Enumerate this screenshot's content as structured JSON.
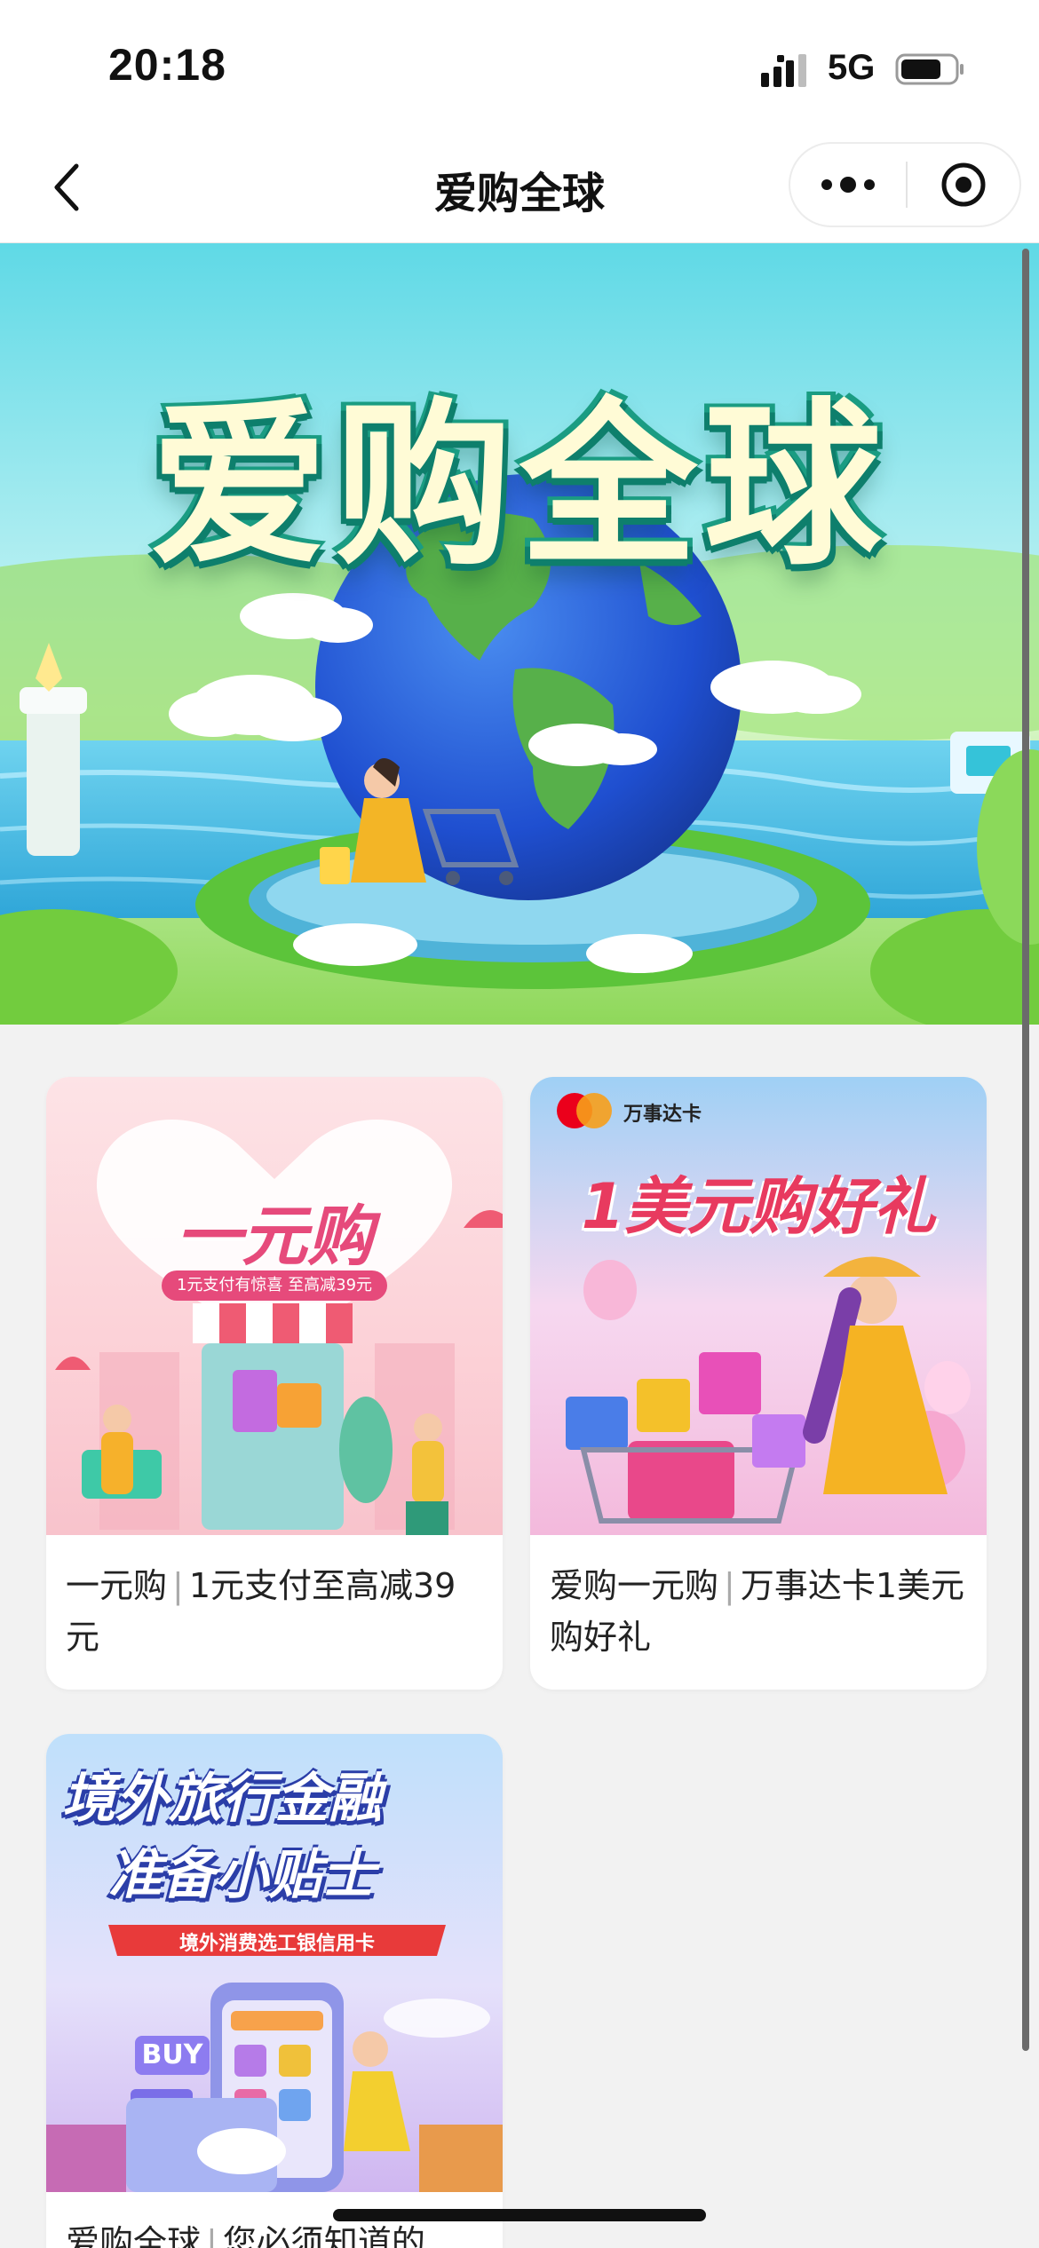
{
  "status_bar": {
    "time": "20:18",
    "network": "5G"
  },
  "nav": {
    "title": "爱购全球"
  },
  "hero": {
    "title": "爱购全球"
  },
  "cards": [
    {
      "image_title": "一元购",
      "image_subtitle": "1元支付有惊喜 至高减39元",
      "title": "一元购",
      "desc": "1元支付至高减39元"
    },
    {
      "image_brand": "万事达卡",
      "image_title": "1美元购好礼",
      "title": "爱购一元购",
      "desc": "万事达卡1美元购好礼"
    },
    {
      "image_title_line1": "境外旅行金融",
      "image_title_line2": "准备小贴士",
      "image_ribbon": "境外消费选工银信用卡",
      "image_buy": "BUY",
      "title": "爱购全球",
      "desc": "您必须知道的"
    }
  ],
  "colors": {
    "accent_green": "#0e7f6c",
    "pink": "#e64a7b",
    "mastercard_red": "#eb001b",
    "mastercard_orange": "#f79e1b"
  }
}
